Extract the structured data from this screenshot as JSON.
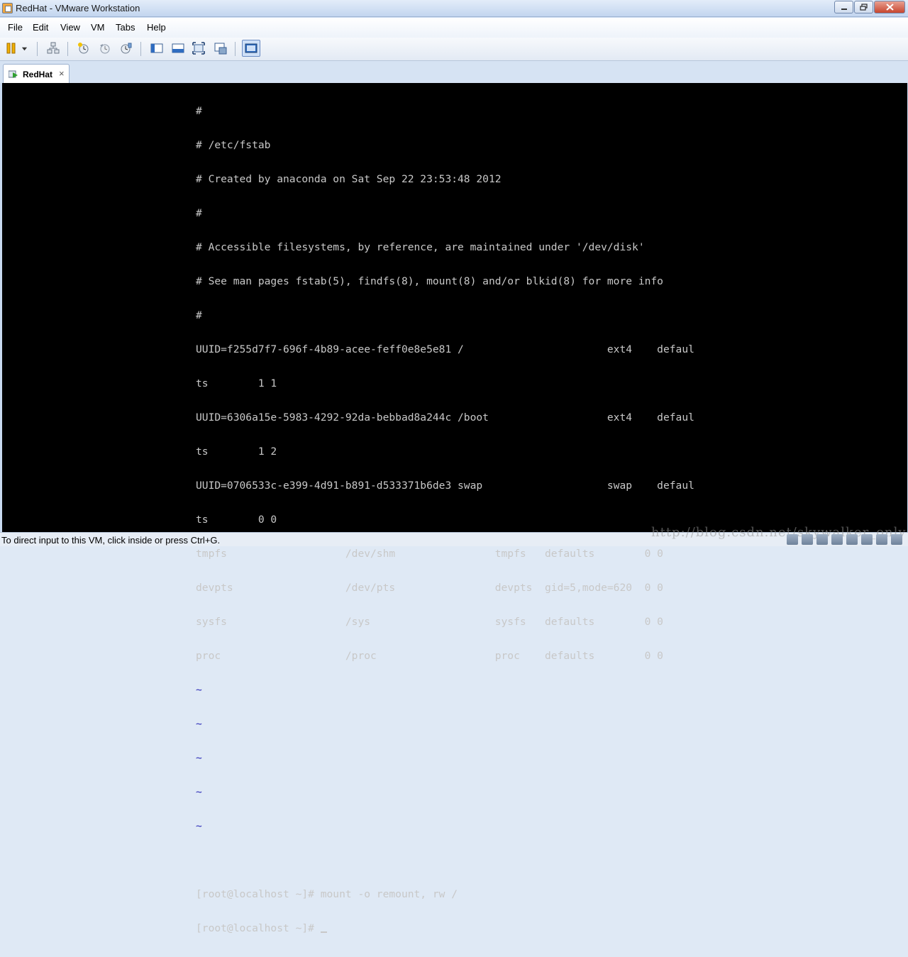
{
  "window": {
    "title": "RedHat - VMware Workstation",
    "controls": [
      "minimize",
      "restore",
      "close"
    ]
  },
  "menu": {
    "items": [
      "File",
      "Edit",
      "View",
      "VM",
      "Tabs",
      "Help"
    ]
  },
  "toolbar": {
    "buttons": [
      {
        "name": "pause-icon"
      },
      {
        "name": "dropdown-icon"
      },
      {
        "name": "send-ctrl-alt-del-icon"
      },
      {
        "name": "take-snapshot-icon"
      },
      {
        "name": "revert-snapshot-icon"
      },
      {
        "name": "snapshot-manager-icon"
      },
      {
        "name": "show-library-icon"
      },
      {
        "name": "quick-switch-icon"
      },
      {
        "name": "full-screen-icon"
      },
      {
        "name": "unity-icon"
      },
      {
        "name": "console-view-icon"
      }
    ]
  },
  "tabs": [
    {
      "label": "RedHat",
      "close": "×"
    }
  ],
  "terminal": {
    "lines": [
      "#",
      "# /etc/fstab",
      "# Created by anaconda on Sat Sep 22 23:53:48 2012",
      "#",
      "# Accessible filesystems, by reference, are maintained under '/dev/disk'",
      "# See man pages fstab(5), findfs(8), mount(8) and/or blkid(8) for more info",
      "#",
      "UUID=f255d7f7-696f-4b89-acee-feff0e8e5e81 /                       ext4    defaul",
      "ts        1 1",
      "UUID=6306a15e-5983-4292-92da-bebbad8a244c /boot                   ext4    defaul",
      "ts        1 2",
      "UUID=0706533c-e399-4d91-b891-d533371b6de3 swap                    swap    defaul",
      "ts        0 0",
      "tmpfs                   /dev/shm                tmpfs   defaults        0 0",
      "devpts                  /dev/pts                devpts  gid=5,mode=620  0 0",
      "sysfs                   /sys                    sysfs   defaults        0 0",
      "proc                    /proc                   proc    defaults        0 0"
    ],
    "tildes": [
      "~",
      "~",
      "~",
      "~",
      "~"
    ],
    "prompt_lines": [
      "[root@localhost ~]# mount -o remount, rw /",
      "[root@localhost ~]# "
    ]
  },
  "status": {
    "message": "To direct input to this VM, click inside or press Ctrl+G.",
    "watermark": "http://blog.csdn.net/skywalker_only"
  },
  "colors": {
    "console_bg": "#000000",
    "console_fg": "#c8c8c8",
    "tilde": "#2e2eb8",
    "chrome": "#c9daf0"
  }
}
